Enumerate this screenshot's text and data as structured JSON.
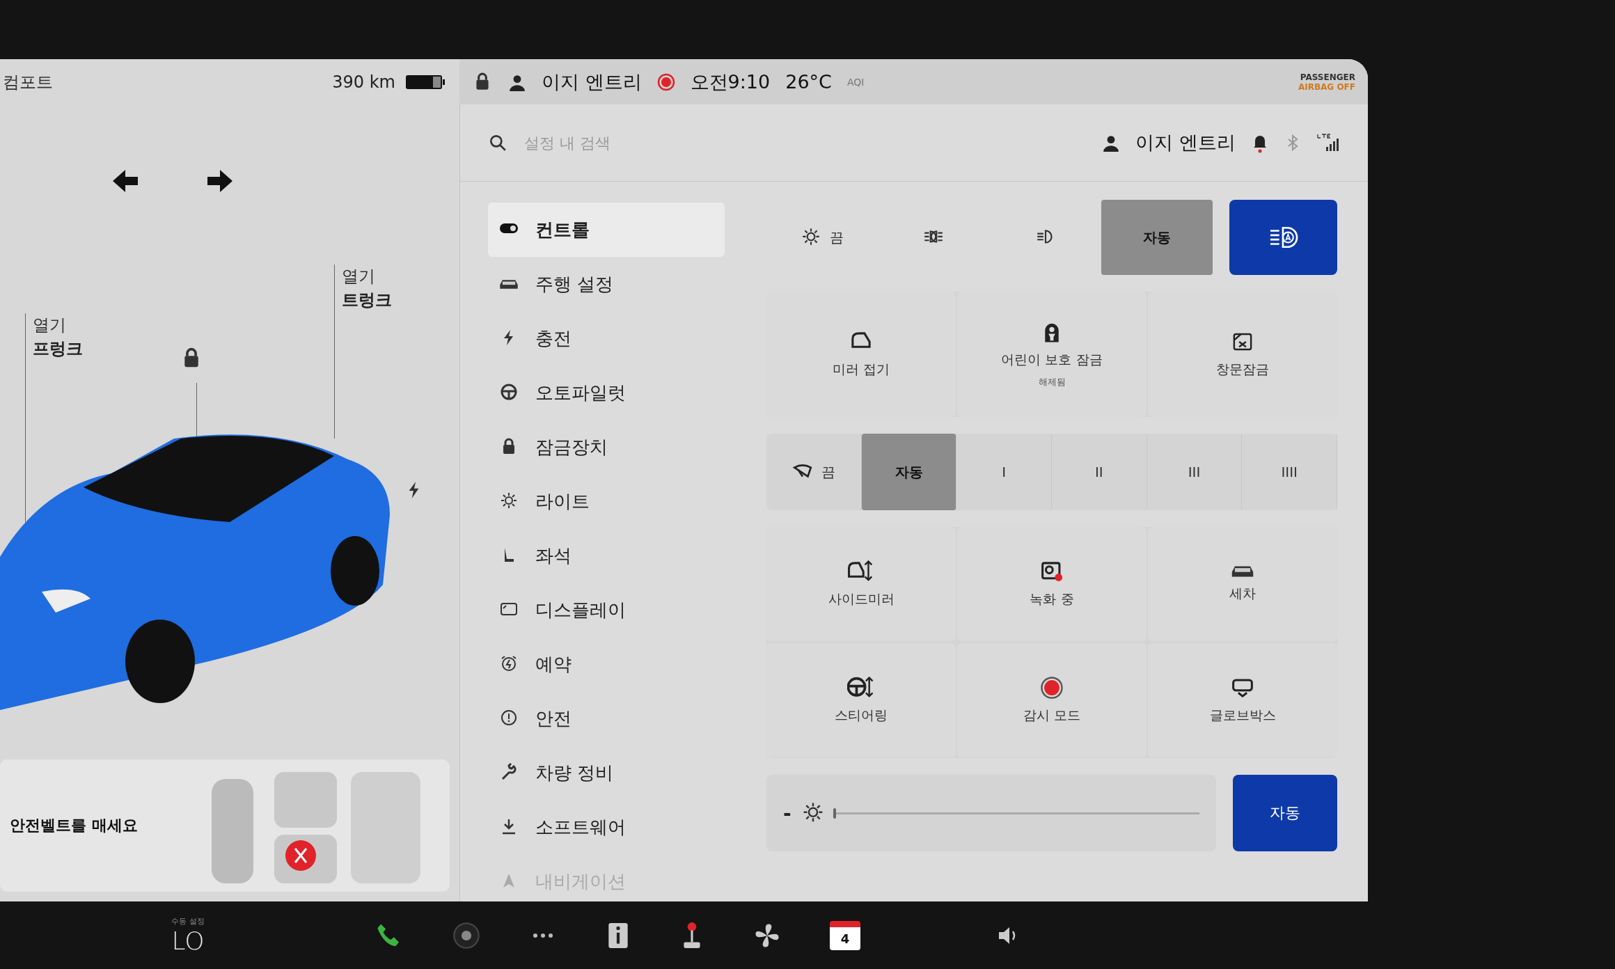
{
  "status_bar": {
    "drive_mode": "컴포트",
    "range": "390 km",
    "profile": "이지 엔트리",
    "time": "오전9:10",
    "temperature": "26°C",
    "aqi": "AQI",
    "airbag_line_1": "PASSENGER",
    "airbag_line_2": "AIRBAG OFF"
  },
  "car_panel": {
    "frunk": {
      "action": "열기",
      "label": "프렁크"
    },
    "trunk": {
      "action": "열기",
      "label": "트렁크"
    },
    "seatbelt_message": "안전벨트를 매세요"
  },
  "settings": {
    "search_placeholder": "설정 내 검색",
    "profile": "이지 엔트리",
    "menu": [
      {
        "label": "컨트롤",
        "selected": true
      },
      {
        "label": "주행 설정",
        "selected": false
      },
      {
        "label": "충전",
        "selected": false
      },
      {
        "label": "오토파일럿",
        "selected": false
      },
      {
        "label": "잠금장치",
        "selected": false
      },
      {
        "label": "라이트",
        "selected": false
      },
      {
        "label": "좌석",
        "selected": false
      },
      {
        "label": "디스플레이",
        "selected": false
      },
      {
        "label": "예약",
        "selected": false
      },
      {
        "label": "안전",
        "selected": false
      },
      {
        "label": "차량 정비",
        "selected": false
      },
      {
        "label": "소프트웨어",
        "selected": false
      },
      {
        "label": "내비게이션",
        "selected": false
      }
    ],
    "headlights": [
      {
        "label": "끔",
        "selected": false
      },
      {
        "selected": false
      },
      {
        "selected": false
      },
      {
        "label": "자동",
        "selected": true
      }
    ],
    "auto_high_beam": {
      "on": true
    },
    "quick_tiles": [
      {
        "label": "미러 접기"
      },
      {
        "label": "어린이 보호 잠금",
        "sublabel": "해제됨"
      },
      {
        "label": "창문잠금"
      }
    ],
    "wipers": [
      {
        "label": "끔",
        "selected": false
      },
      {
        "label": "자동",
        "selected": true
      },
      {
        "label": "I",
        "selected": false
      },
      {
        "label": "II",
        "selected": false
      },
      {
        "label": "III",
        "selected": false
      },
      {
        "label": "IIII",
        "selected": false
      }
    ],
    "tiles": [
      {
        "label": "사이드미러"
      },
      {
        "label": "녹화 중"
      },
      {
        "label": "세차"
      },
      {
        "label": "스티어링"
      },
      {
        "label": "감시 모드"
      },
      {
        "label": "글로브박스"
      }
    ],
    "brightness": {
      "minus": "-",
      "level": 0,
      "auto": {
        "label": "자동",
        "on": true
      }
    }
  },
  "taskbar": {
    "climate_caption": "수동 설정",
    "climate_value": "LO",
    "calendar_day": "4"
  }
}
